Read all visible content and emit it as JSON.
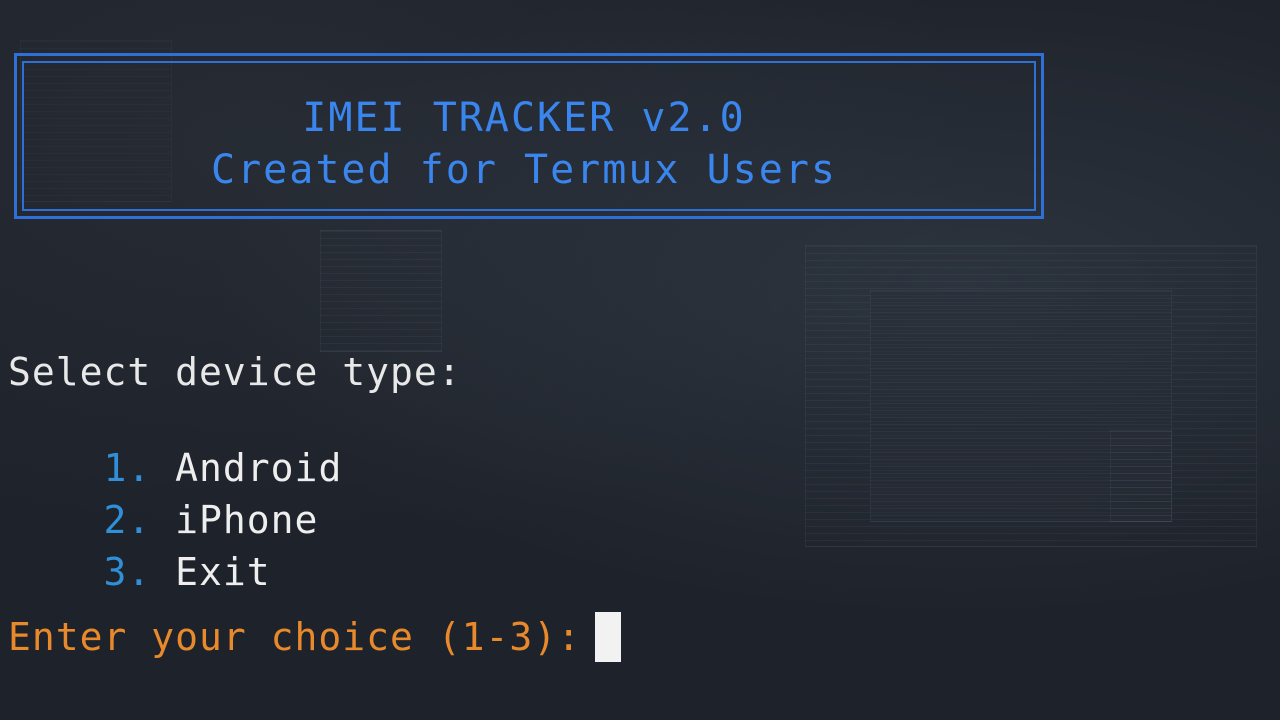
{
  "banner": {
    "title": "IMEI TRACKER v2.0",
    "subtitle": "Created for Termux Users"
  },
  "menu": {
    "prompt": "Select device type:",
    "options": [
      {
        "number": "1.",
        "label": "Android"
      },
      {
        "number": "2.",
        "label": "iPhone"
      },
      {
        "number": "3.",
        "label": "Exit"
      }
    ]
  },
  "input": {
    "prompt": "Enter your choice (1-3):",
    "value": ""
  },
  "colors": {
    "background": "#1e222a",
    "banner_border": "#2f6fd8",
    "banner_text": "#3a86ee",
    "option_number": "#2f8fd8",
    "menu_text": "#eeeeee",
    "input_prompt": "#e8892c",
    "cursor": "#f2f2f2"
  }
}
